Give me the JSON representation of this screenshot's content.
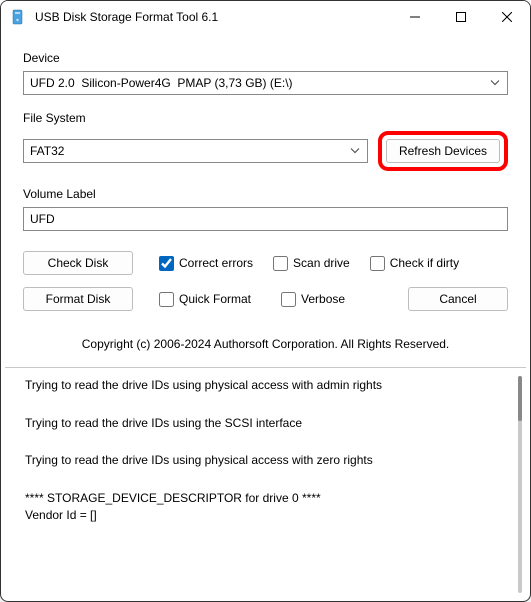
{
  "window": {
    "title": "USB Disk Storage Format Tool 6.1"
  },
  "device": {
    "label": "Device",
    "value": "UFD 2.0  Silicon-Power4G  PMAP (3,73 GB) (E:\\)"
  },
  "filesystem": {
    "label": "File System",
    "value": "FAT32",
    "refresh_label": "Refresh Devices"
  },
  "volume": {
    "label": "Volume Label",
    "value": "UFD"
  },
  "check": {
    "button": "Check Disk",
    "correct_errors": "Correct errors",
    "scan_drive": "Scan drive",
    "check_if_dirty": "Check if dirty",
    "correct_errors_checked": true,
    "scan_drive_checked": false,
    "check_if_dirty_checked": false
  },
  "format": {
    "button": "Format Disk",
    "quick": "Quick Format",
    "verbose": "Verbose",
    "cancel": "Cancel",
    "quick_checked": false,
    "verbose_checked": false
  },
  "copyright": "Copyright (c) 2006-2024 Authorsoft Corporation. All Rights Reserved.",
  "log": {
    "lines": [
      "Trying to read the drive IDs using physical access with admin rights",
      "Trying to read the drive IDs using the SCSI interface",
      "Trying to read the drive IDs using physical access with zero rights",
      "**** STORAGE_DEVICE_DESCRIPTOR for drive 0 ****",
      "Vendor Id = []"
    ]
  }
}
